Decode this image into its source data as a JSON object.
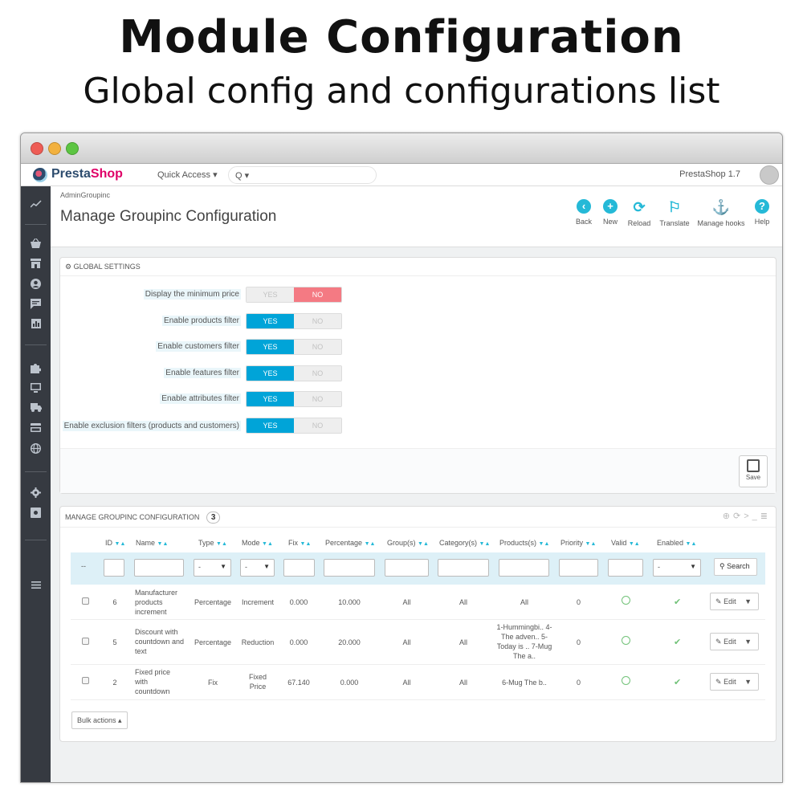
{
  "promo": {
    "title": "Module Configuration",
    "subtitle": "Global config and configurations list"
  },
  "topbar": {
    "logo_presta": "Presta",
    "logo_shop": "Shop",
    "quick_access": "Quick Access ▾",
    "search_glyph": "Q ▾",
    "version": "PrestaShop 1.7"
  },
  "header": {
    "breadcrumb": "AdminGroupinc",
    "title": "Manage Groupinc Configuration",
    "toolbar": [
      {
        "label": "Back",
        "icon": "back-icon"
      },
      {
        "label": "New",
        "icon": "plus-icon"
      },
      {
        "label": "Reload",
        "icon": "refresh-icon"
      },
      {
        "label": "Translate",
        "icon": "flag-icon"
      },
      {
        "label": "Manage hooks",
        "icon": "anchor-icon"
      },
      {
        "label": "Help",
        "icon": "help-icon"
      }
    ]
  },
  "global_settings": {
    "heading": "GLOBAL SETTINGS",
    "yes_label": "YES",
    "no_label": "NO",
    "settings": [
      {
        "label": "Display the minimum price",
        "value": "NO"
      },
      {
        "label": "Enable products filter",
        "value": "YES"
      },
      {
        "label": "Enable customers filter",
        "value": "YES"
      },
      {
        "label": "Enable features filter",
        "value": "YES"
      },
      {
        "label": "Enable attributes filter",
        "value": "YES"
      },
      {
        "label": "Enable exclusion filters (products and customers)",
        "value": "YES"
      }
    ],
    "save_label": "Save"
  },
  "config_list": {
    "heading": "MANAGE GROUPINC CONFIGURATION",
    "count": "3",
    "columns": [
      "ID",
      "Name",
      "Type",
      "Mode",
      "Fix",
      "Percentage",
      "Group(s)",
      "Category(s)",
      "Products(s)",
      "Priority",
      "Valid",
      "Enabled"
    ],
    "filter_placeholder_dash": "--",
    "filter_select": "-",
    "search_label": "Search",
    "rows": [
      {
        "id": "6",
        "name": "Manufacturer products increment",
        "type": "Percentage",
        "mode": "Increment",
        "fix": "0.000",
        "percentage": "10.000",
        "groups": "All",
        "categories": "All",
        "products": "All",
        "priority": "0",
        "edit": "Edit"
      },
      {
        "id": "5",
        "name": "Discount with countdown and text",
        "type": "Percentage",
        "mode": "Reduction",
        "fix": "0.000",
        "percentage": "20.000",
        "groups": "All",
        "categories": "All",
        "products": "1-Hummingbi.. 4-The adven.. 5-Today is .. 7-Mug The a..",
        "priority": "0",
        "edit": "Edit"
      },
      {
        "id": "2",
        "name": "Fixed price with countdown",
        "type": "Fix",
        "mode": "Fixed Price",
        "fix": "67.140",
        "percentage": "0.000",
        "groups": "All",
        "categories": "All",
        "products": "6-Mug The b..",
        "priority": "0",
        "edit": "Edit"
      }
    ],
    "bulk_actions": "Bulk actions ▴"
  },
  "colors": {
    "accent": "#25b9d7",
    "toggle_yes": "#00a4d8",
    "toggle_no": "#f47a83",
    "sidebar": "#363a41",
    "valid_green": "#72c279"
  }
}
